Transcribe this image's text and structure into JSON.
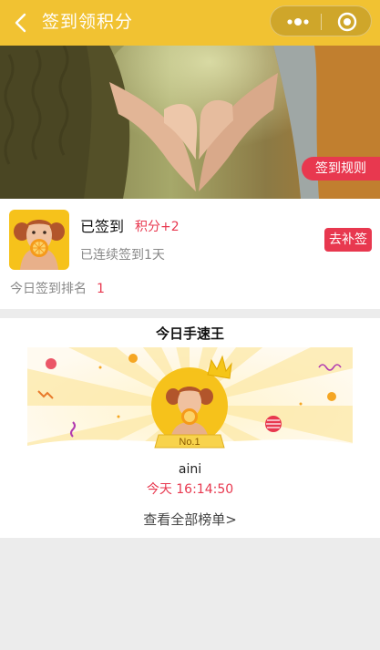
{
  "nav": {
    "title": "签到领积分",
    "back_icon": "chevron-left-icon",
    "more_icon": "more-dots-icon",
    "close_icon": "target-circle-icon"
  },
  "banner": {
    "rule_button": "签到规则"
  },
  "sign": {
    "status": "已签到",
    "points": "积分+2",
    "streak": "已连续签到1天",
    "makeup_button": "去补签",
    "rank_label": "今日签到排名",
    "rank_value": "1"
  },
  "king": {
    "title": "今日手速王",
    "badge": "No.1",
    "name": "aini",
    "time": "今天 16:14:50",
    "view_all": "查看全部榜单>"
  },
  "colors": {
    "brand": "#f1c232",
    "accent": "#e8384f",
    "background": "#ececec"
  }
}
